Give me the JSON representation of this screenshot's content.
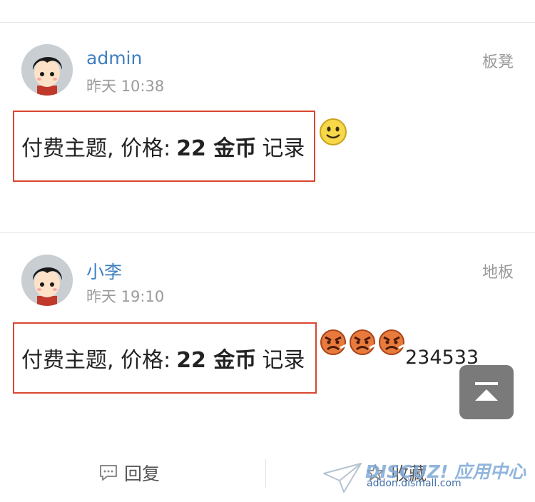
{
  "posts": [
    {
      "username": "admin",
      "time": "昨天 10:38",
      "floor": "板凳",
      "paid_prefix": "付费主题, 价格:",
      "paid_amount": "22 金币",
      "paid_suffix": "记录",
      "emoticons": [
        "smile-icon"
      ],
      "extra_text": ""
    },
    {
      "username": "小李",
      "time": "昨天 19:10",
      "floor": "地板",
      "paid_prefix": "付费主题, 价格:",
      "paid_amount": "22 金币",
      "paid_suffix": "记录",
      "emoticons": [
        "angry-icon",
        "angry-icon",
        "angry-icon"
      ],
      "extra_text": "234533"
    }
  ],
  "footer": {
    "reply_label": "回复",
    "favorite_label": "收藏"
  },
  "watermark": {
    "brand": "DISCUZ! 应用中心",
    "url": "addon.dismall.com"
  },
  "colors": {
    "link": "#3f7fc2",
    "highlight_border": "#d9472f",
    "meta": "#9a9a9a"
  }
}
